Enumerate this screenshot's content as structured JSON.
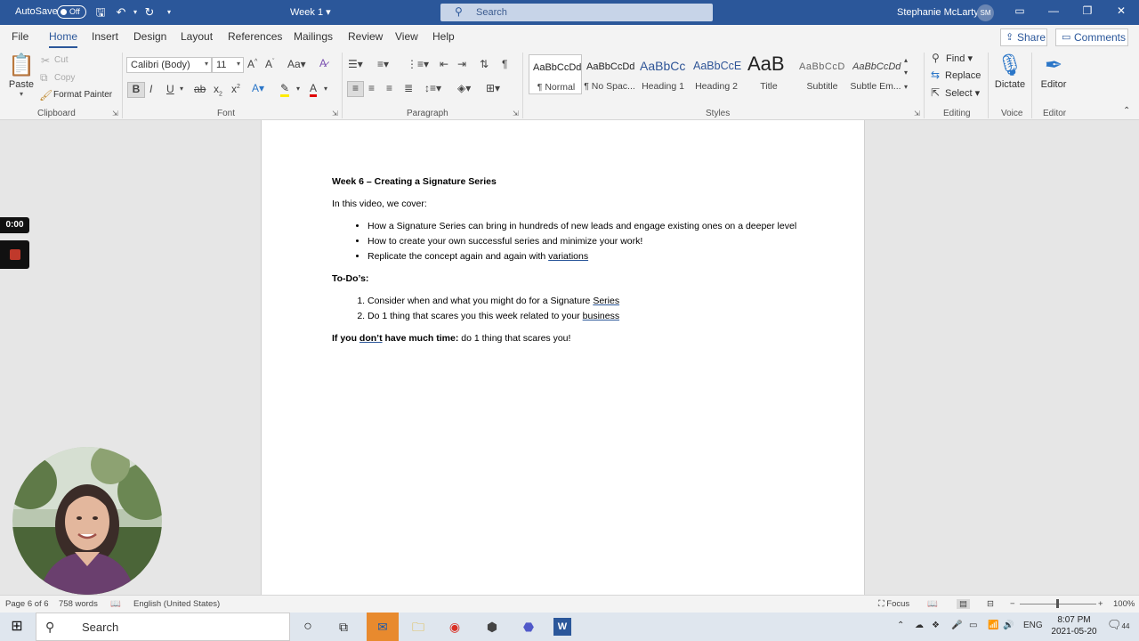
{
  "titlebar": {
    "autosave_label": "AutoSave",
    "autosave_state": "Off",
    "doc_title": "Week 1",
    "search_placeholder": "Search",
    "user_name": "Stephanie McLarty",
    "user_initials": "SM"
  },
  "tabs": [
    "File",
    "Home",
    "Insert",
    "Design",
    "Layout",
    "References",
    "Mailings",
    "Review",
    "View",
    "Help"
  ],
  "active_tab": "Home",
  "share_label": "Share",
  "comments_label": "Comments",
  "clipboard": {
    "paste": "Paste",
    "cut": "Cut",
    "copy": "Copy",
    "format_painter": "Format Painter",
    "group": "Clipboard"
  },
  "font": {
    "family": "Calibri (Body)",
    "size": "11",
    "group": "Font"
  },
  "paragraph_group": "Paragraph",
  "styles": {
    "group": "Styles",
    "items": [
      {
        "preview": "AaBbCcDd",
        "name": "¶ Normal"
      },
      {
        "preview": "AaBbCcDd",
        "name": "¶ No Spac..."
      },
      {
        "preview": "AaBbCc",
        "name": "Heading 1"
      },
      {
        "preview": "AaBbCcE",
        "name": "Heading 2"
      },
      {
        "preview": "AaB",
        "name": "Title"
      },
      {
        "preview": "AaBbCcD",
        "name": "Subtitle"
      },
      {
        "preview": "AaBbCcDd",
        "name": "Subtle Em..."
      }
    ]
  },
  "editing": {
    "find": "Find",
    "replace": "Replace",
    "select": "Select",
    "group": "Editing"
  },
  "voice": {
    "dictate": "Dictate",
    "group": "Voice"
  },
  "editor": {
    "label": "Editor",
    "group": "Editor"
  },
  "document": {
    "heading": "Week 6 – Creating a Signature Series",
    "intro": "In this video, we cover:",
    "bullets": [
      "How a Signature Series can bring in hundreds of new leads and engage existing ones on a deeper level",
      "How to create your own successful series and minimize your work!",
      "Replicate the concept again and again with "
    ],
    "bullet3_underlined": "variations",
    "todo_heading": "To-Do’s:",
    "todos_pre": [
      "Consider when and what you might do for a Signature ",
      "Do 1 thing that scares you this week related to your "
    ],
    "todos_underlined": [
      "Series",
      "business"
    ],
    "closing_bold_pre": "If you ",
    "closing_bold_u": "don’t",
    "closing_bold_post": " have much time:",
    "closing_rest": " do 1 thing that scares you!"
  },
  "recording": {
    "time": "0:00"
  },
  "statusbar": {
    "page": "Page 6 of 6",
    "words": "758 words",
    "language": "English (United States)",
    "focus": "Focus",
    "zoom": "100%"
  },
  "taskbar": {
    "search_placeholder": "Search",
    "lang": "ENG",
    "time": "8:07 PM",
    "date": "2021-05-20",
    "notifications": "44"
  },
  "colors": {
    "word_blue": "#2b579a",
    "accent_blue": "#2b76c8"
  }
}
